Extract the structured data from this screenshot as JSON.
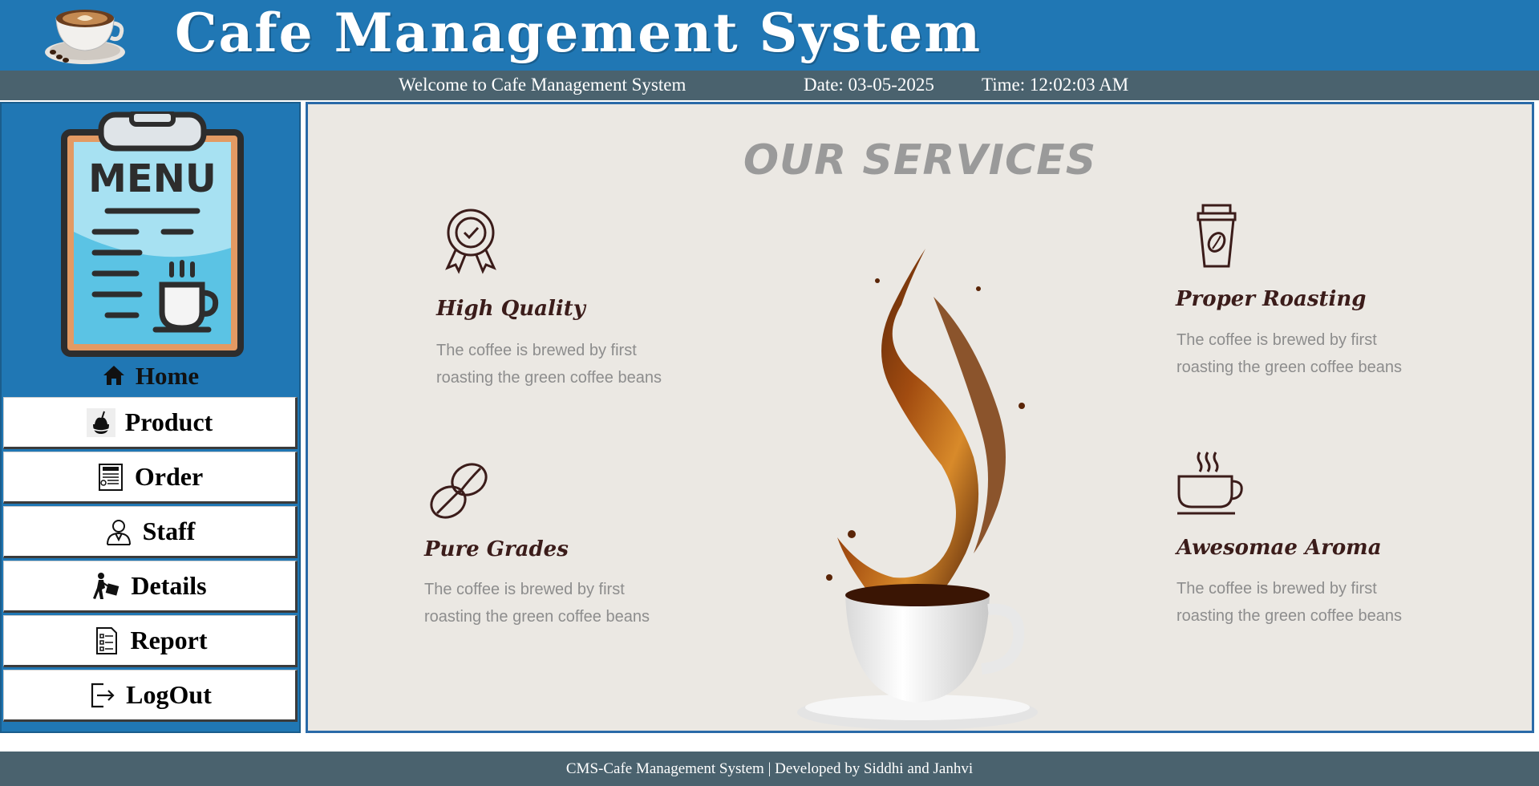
{
  "header": {
    "title": "Cafe Management System",
    "logo_icon": "coffee-cup-icon"
  },
  "infobar": {
    "welcome": "Welcome to Cafe Management System",
    "date": "Date: 03-05-2025",
    "time": "Time: 12:02:03 AM"
  },
  "sidebar": {
    "logo_text": "MENU",
    "home_label": "Home",
    "items": [
      {
        "label": "Product",
        "icon": "product-icon"
      },
      {
        "label": "Order",
        "icon": "bill-icon"
      },
      {
        "label": "Staff",
        "icon": "staff-icon"
      },
      {
        "label": "Details",
        "icon": "delivery-icon"
      },
      {
        "label": "Report",
        "icon": "report-icon"
      },
      {
        "label": "LogOut",
        "icon": "logout-icon"
      }
    ]
  },
  "main": {
    "title": "OUR SERVICES",
    "services": [
      {
        "title": "High Quality",
        "desc": "The coffee is brewed by first roasting the green coffee beans",
        "icon": "award-badge-icon"
      },
      {
        "title": "Proper Roasting",
        "desc": "The coffee is brewed by first roasting the green coffee beans",
        "icon": "takeaway-cup-icon"
      },
      {
        "title": "Pure Grades",
        "desc": "The coffee is brewed by first roasting the green coffee beans",
        "icon": "coffee-beans-icon"
      },
      {
        "title": "Awesomae Aroma",
        "desc": "The coffee is brewed by first roasting the green coffee beans",
        "icon": "hot-cup-icon"
      }
    ]
  },
  "footer": {
    "text": "CMS-Cafe Management System | Developed by Siddhi and Janhvi"
  },
  "colors": {
    "header_blue": "#2077b4",
    "bar_slate": "#4a626e",
    "panel_bg": "#ebe8e3",
    "service_title": "#3b1c1a"
  }
}
